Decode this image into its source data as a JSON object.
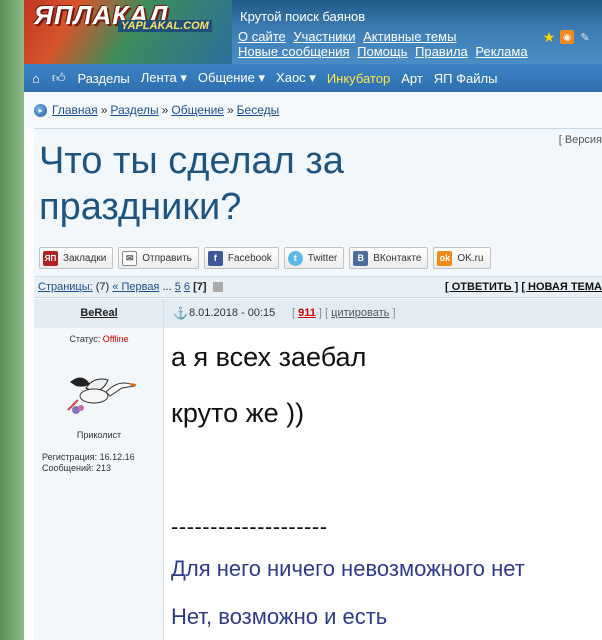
{
  "header": {
    "logo_text": "ЯПЛАКАЛ",
    "logo_sub": "YAPLAKAL.COM",
    "tagline": "Крутой поиск баянов",
    "links_row1": [
      "О сайте",
      "Участники",
      "Активные темы"
    ],
    "links_row2": [
      "Новые сообщения",
      "Помощь",
      "Правила",
      "Реклама"
    ],
    "icons": [
      "star-icon",
      "rss-icon",
      "pencil-icon"
    ]
  },
  "nav": {
    "items": [
      "Разделы",
      "Лента ▾",
      "Общение ▾",
      "Хаос ▾",
      "Инкубатор",
      "Арт",
      "ЯП Файлы"
    ],
    "highlight_index": 4,
    "highlight_color": "#ffe34d"
  },
  "breadcrumb": {
    "items": [
      "Главная",
      "Разделы",
      "Общение",
      "Беседы"
    ],
    "separator": "»"
  },
  "topic": {
    "title": "Что ты сделал за праздники?",
    "version_link": "[ Версия"
  },
  "share": {
    "buttons": [
      "Закладки",
      "Отправить",
      "Facebook",
      "Twitter",
      "ВКонтакте",
      "OK.ru"
    ]
  },
  "pager": {
    "label": "Страницы:",
    "count": "(7)",
    "first": "« Первая",
    "ellipsis": "...",
    "pages": [
      "5",
      "6"
    ],
    "current": "[7]",
    "reply": "[ ОТВЕТИТЬ ]",
    "new_topic": "[ НОВАЯ ТЕМА"
  },
  "post": {
    "author": "BeReal",
    "status_label": "Статус:",
    "status_value": "Offline",
    "rank": "Приколист",
    "registration": "Регистрация: 16.12.16",
    "messages": "Сообщений: 213",
    "date": "8.01.2018 - 00:15",
    "number": "911",
    "quote": "цитировать",
    "line1": "а я всех заебал",
    "line2": "круто же ))",
    "signature_divider": "--------------------",
    "signature1": "Для него ничего невозможного нет",
    "signature2": "Нет, возможно и есть"
  }
}
